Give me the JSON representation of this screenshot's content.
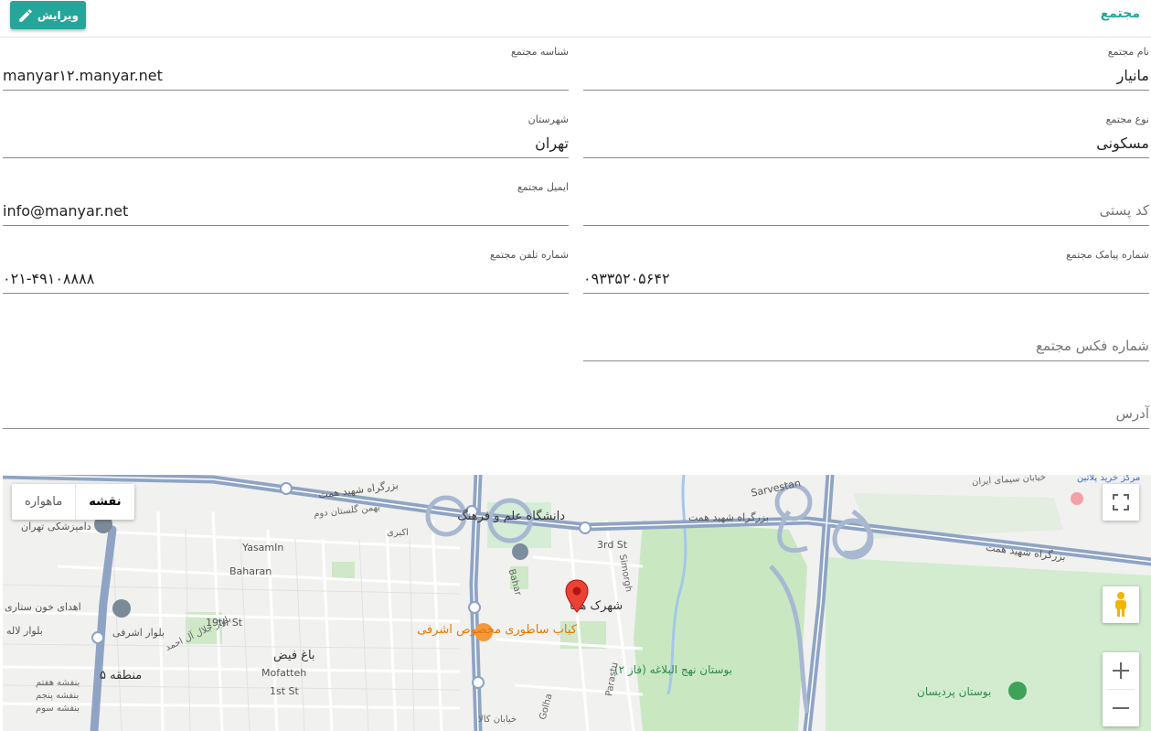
{
  "header": {
    "title": "مجتمع",
    "edit_label": "ویرایش"
  },
  "fields": {
    "complex_name": {
      "label": "نام مجتمع",
      "value": "مانیار"
    },
    "complex_id": {
      "label": "شناسه مجتمع",
      "value": "manyar۱۲.manyar.net"
    },
    "complex_type": {
      "label": "نوع مجتمع",
      "value": "مسکونی"
    },
    "city": {
      "label": "شهرستان",
      "value": "تهران"
    },
    "postal_code": {
      "placeholder": "کد پستی"
    },
    "email": {
      "label": "ایمیل مجتمع",
      "value": "info@manyar.net"
    },
    "sms_number": {
      "label": "شماره پیامک مجتمع",
      "value": "۰۹۳۳۵۲۰۵۶۴۲"
    },
    "phone": {
      "label": "شماره تلفن مجتمع",
      "value": "۰۲۱-۴۹۱۰۸۸۸۸"
    },
    "fax": {
      "placeholder": "شماره فکس مجتمع"
    },
    "address": {
      "placeholder": "آدرس"
    }
  },
  "map": {
    "map_type_options": [
      "نقشه",
      "ماهواره"
    ],
    "selected_type": "نقشه",
    "labels": {
      "highway_1": "بزرگراه شهید همت",
      "highway_2": "بزرگراه شهید همت",
      "highway_3": "بزرگراه شهید همت",
      "univ": "دانشگاه علم و فرهنگ",
      "sarvestan": "Sarvestan",
      "third_st": "3rd St",
      "simorgh": "Simorgh",
      "bahar": "Bahar",
      "yasamin": "YasamIn",
      "baharan": "Baharan",
      "st19": "19th St",
      "shahrak": "شهرک هما",
      "kebab": "کباب ساطوری مخصوص اشرفی",
      "nahj_park": "بوستان نهج البلاغه (فاز ۲)",
      "pardisan_park": "بوستان پردیسان",
      "blood": "اهدای خون ستاری",
      "vet": "دامپزشکی تهران",
      "district5": "منطقه ۵",
      "bagh_feyz": "باغ فیض",
      "mofatteh": "Mofatteh",
      "first_st": "1st St",
      "parastu": "Parastu",
      "golha": "Golha",
      "sima_st": "خیابان سیمای ایران",
      "kalah": "خیابان کالا",
      "akbari": "اکبری",
      "golestan": "بهمن گلستان دوم",
      "bolvar_laleh": "بلوار لاله",
      "bolvar_ashrafi": "بلوار اشرفی",
      "beheshti": "بلوار جلال آل احمد",
      "banafsheh7": "بنفشه هفتم",
      "banafsheh5": "بنفشه پنجم",
      "banafsheh3": "بنفشه سوم",
      "mall": "مرکز خرید پلاتین"
    }
  },
  "colors": {
    "accent": "#26a69a",
    "highway": "#8fa4c4",
    "park": "#c9e8c2",
    "pin": "#ea4335"
  }
}
